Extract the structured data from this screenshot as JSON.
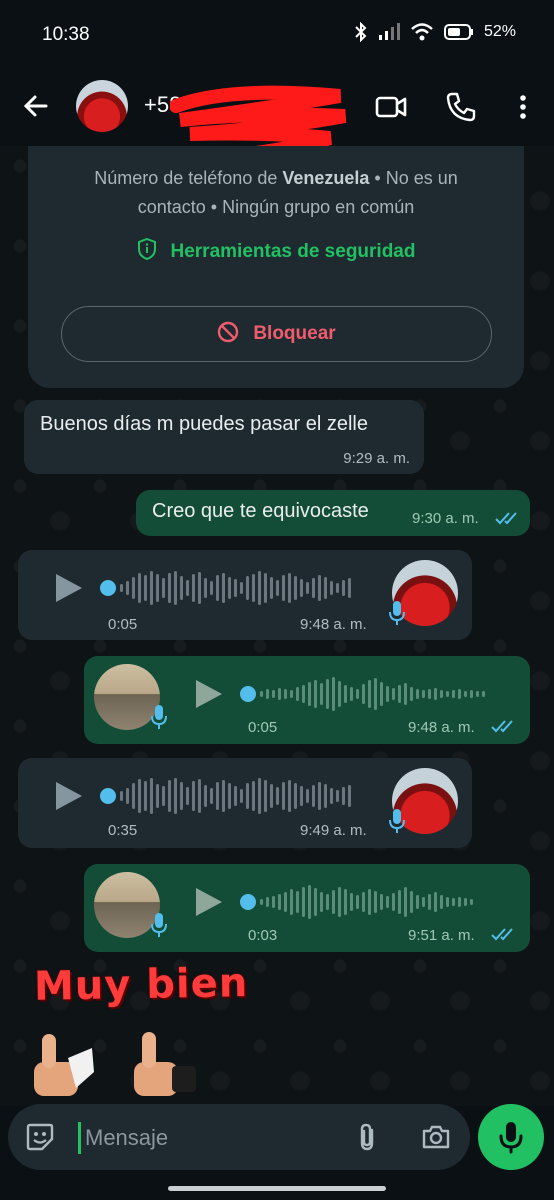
{
  "status": {
    "time": "10:38",
    "battery": "52%"
  },
  "header": {
    "contact": "+58"
  },
  "info": {
    "line_prefix": "Número de teléfono de ",
    "country": "Venezuela",
    "line_rest": " • No es un contacto • Ningún grupo en común",
    "security_label": "Herramientas de seguridad",
    "block_label": "Bloquear"
  },
  "messages": [
    {
      "type": "text",
      "direction": "in",
      "text": "Buenos días m puedes pasar el zelle",
      "time": "9:29 a. m."
    },
    {
      "type": "text",
      "direction": "out",
      "text": "Creo que te equivocaste",
      "time": "9:30 a. m."
    },
    {
      "type": "voice",
      "direction": "in",
      "duration": "0:05",
      "time": "9:48 a. m."
    },
    {
      "type": "voice",
      "direction": "out",
      "duration": "0:05",
      "time": "9:48 a. m."
    },
    {
      "type": "voice",
      "direction": "in",
      "duration": "0:35",
      "time": "9:49 a. m."
    },
    {
      "type": "voice",
      "direction": "out",
      "duration": "0:03",
      "time": "9:51 a. m."
    }
  ],
  "sticker": {
    "text": "Muy bien"
  },
  "input": {
    "placeholder": "Mensaje"
  },
  "colors": {
    "accent": "#21c063",
    "outgoing": "#144d37",
    "incoming": "#1f2a30",
    "tick_read": "#53bdeb",
    "danger": "#f15c6d"
  }
}
